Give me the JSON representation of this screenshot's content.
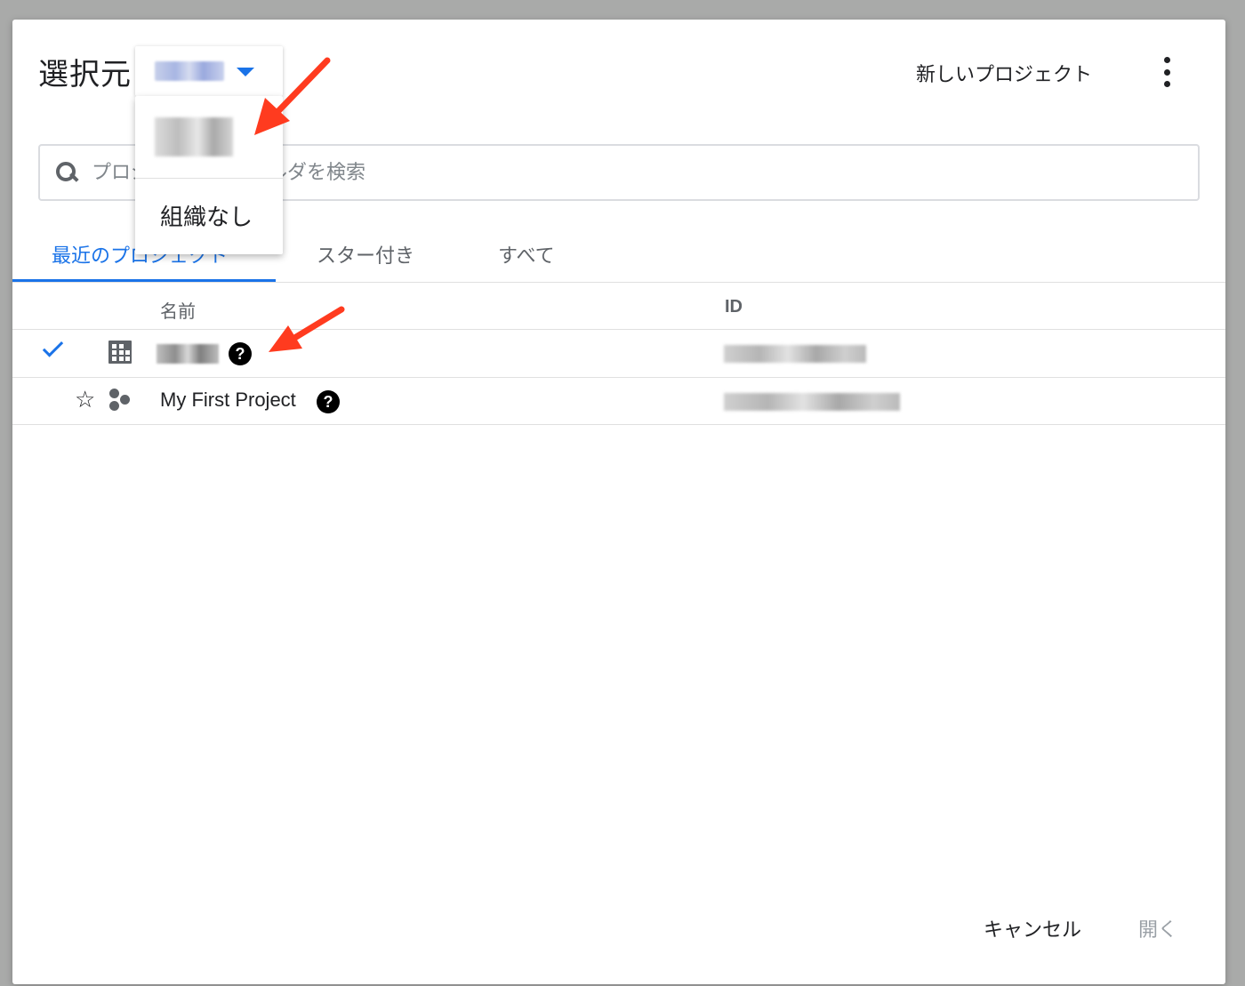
{
  "dialog": {
    "title": "選択元",
    "org_select": {
      "value_blurred": true
    },
    "org_menu": {
      "item_none": "組織なし"
    },
    "new_project": "新しいプロジェクト"
  },
  "search": {
    "placeholder": "プロジェクトとフォルダを検索",
    "icon": "search-icon"
  },
  "tabs": [
    {
      "label": "最近のプロジェクト",
      "active": true
    },
    {
      "label": "スター付き",
      "active": false
    },
    {
      "label": "すべて",
      "active": false
    }
  ],
  "table": {
    "headers": {
      "name": "名前",
      "id": "ID"
    },
    "rows": [
      {
        "selected": true,
        "icon": "organization-icon",
        "name_blurred": true,
        "help": "?"
      },
      {
        "selected": false,
        "starred": false,
        "icon": "project-icon",
        "name": "My First Project",
        "help": "?"
      }
    ]
  },
  "footer": {
    "cancel": "キャンセル",
    "open": "開く"
  },
  "colors": {
    "accent": "#1a73e8",
    "annotation": "#ff3b1f",
    "disabled": "#9aa0a6"
  }
}
